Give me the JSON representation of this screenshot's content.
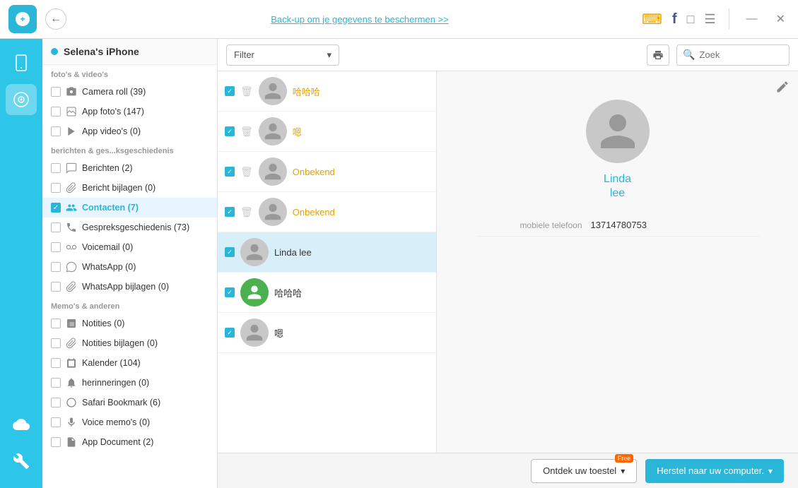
{
  "titlebar": {
    "back_label": "←",
    "backup_link": "Back-up om je gegevens te beschermen >>",
    "icons": [
      "ornament",
      "facebook",
      "chat",
      "menu"
    ],
    "win_minimize": "—",
    "win_close": "✕"
  },
  "sidebar": {
    "device_name": "Selena's iPhone",
    "sections": [
      {
        "label": "foto's & video's",
        "items": [
          {
            "id": "camera-roll",
            "label": "Camera roll (39)",
            "checked": false,
            "icon": "📷"
          },
          {
            "id": "app-fotos",
            "label": "App foto's (147)",
            "checked": false,
            "icon": "🖼"
          },
          {
            "id": "app-videos",
            "label": "App video's (0)",
            "checked": false,
            "icon": "▶"
          }
        ]
      },
      {
        "label": "berichten & ges...ksgeschiedenis",
        "items": [
          {
            "id": "berichten",
            "label": "Berichten (2)",
            "checked": false,
            "icon": "💬"
          },
          {
            "id": "bericht-bijlagen",
            "label": "Bericht bijlagen (0)",
            "checked": false,
            "icon": "📎"
          },
          {
            "id": "contacten",
            "label": "Contacten (7)",
            "checked": true,
            "icon": "👤",
            "active": true
          },
          {
            "id": "gespreksgeschiedenis",
            "label": "Gespreksgeschiedenis (73)",
            "checked": false,
            "icon": "📞"
          },
          {
            "id": "voicemail",
            "label": "Voicemail (0)",
            "checked": false,
            "icon": "📩"
          },
          {
            "id": "whatsapp",
            "label": "WhatsApp (0)",
            "checked": false,
            "icon": "💬"
          },
          {
            "id": "whatsapp-bijlagen",
            "label": "WhatsApp bijlagen (0)",
            "checked": false,
            "icon": "📎"
          }
        ]
      },
      {
        "label": "Memo's & anderen",
        "items": [
          {
            "id": "notities",
            "label": "Notities (0)",
            "checked": false,
            "icon": "📋"
          },
          {
            "id": "notities-bijlagen",
            "label": "Notities bijlagen (0)",
            "checked": false,
            "icon": "📎"
          },
          {
            "id": "kalender",
            "label": "Kalender (104)",
            "checked": false,
            "icon": "📅"
          },
          {
            "id": "herinneringen",
            "label": "herinneringen (0)",
            "checked": false,
            "icon": "🔔"
          },
          {
            "id": "safari-bookmark",
            "label": "Safari Bookmark (6)",
            "checked": false,
            "icon": "🔖"
          },
          {
            "id": "voice-memos",
            "label": "Voice memo's (0)",
            "checked": false,
            "icon": "🎙"
          },
          {
            "id": "app-document",
            "label": "App Document (2)",
            "checked": false,
            "icon": "📄"
          }
        ]
      }
    ]
  },
  "toolbar": {
    "filter_label": "Filter",
    "filter_placeholder": "Filter",
    "search_placeholder": "Zoek"
  },
  "contacts": [
    {
      "id": 1,
      "name": "哈哈哈",
      "name_color": "orange",
      "checked": true,
      "has_delete": true,
      "avatar_type": "placeholder"
    },
    {
      "id": 2,
      "name": "嗯",
      "name_color": "orange",
      "checked": true,
      "has_delete": true,
      "avatar_type": "placeholder"
    },
    {
      "id": 3,
      "name": "Onbekend",
      "name_color": "orange",
      "checked": true,
      "has_delete": true,
      "avatar_type": "placeholder"
    },
    {
      "id": 4,
      "name": "Onbekend",
      "name_color": "orange",
      "checked": true,
      "has_delete": true,
      "avatar_type": "placeholder"
    },
    {
      "id": 5,
      "name": "Linda lee",
      "name_color": "normal",
      "checked": true,
      "has_delete": false,
      "avatar_type": "placeholder",
      "selected": true
    },
    {
      "id": 6,
      "name": "哈哈哈",
      "name_color": "normal",
      "checked": true,
      "has_delete": false,
      "avatar_type": "colored"
    },
    {
      "id": 7,
      "name": "嗯",
      "name_color": "normal",
      "checked": true,
      "has_delete": false,
      "avatar_type": "placeholder"
    }
  ],
  "detail": {
    "first_name": "Linda",
    "last_name": "lee",
    "field_label": "mobiele telefoon",
    "field_value": "13714780753"
  },
  "bottom_bar": {
    "discover_label": "Ontdek uw toestel",
    "free_badge": "Free",
    "restore_label": "Herstel naar uw computer.",
    "chevron": "▾"
  },
  "iconbar": {
    "items": [
      {
        "id": "phone",
        "icon": "📱",
        "active": false
      },
      {
        "id": "music",
        "icon": "♪",
        "active": true
      },
      {
        "id": "cloud",
        "icon": "☁",
        "active": false
      },
      {
        "id": "tools",
        "icon": "🔧",
        "active": false
      }
    ]
  }
}
